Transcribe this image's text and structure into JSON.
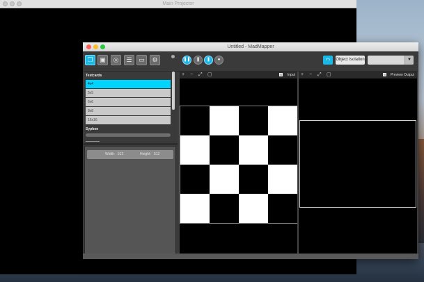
{
  "projector": {
    "title": "Main Projector"
  },
  "madmapper": {
    "title": "Untitled - MadMapper",
    "toolbar": {
      "object_isolation_label": "Object Isolation",
      "dropdown_value": ""
    },
    "sidebar": {
      "testcards_label": "Testcards",
      "testcards": [
        "4x4",
        "5x5",
        "6x6",
        "8x8",
        "16x16"
      ],
      "selected_index": 0,
      "syphon_label": "Syphon",
      "width_label": "Width:",
      "width_value": "512",
      "height_label": "Height:",
      "height_value": "512"
    },
    "input_view": {
      "label": "Input"
    },
    "output_view": {
      "label": "Preview Output"
    }
  },
  "colors": {
    "accent": "#00d4ff",
    "window_bg": "#3c3c3c"
  }
}
